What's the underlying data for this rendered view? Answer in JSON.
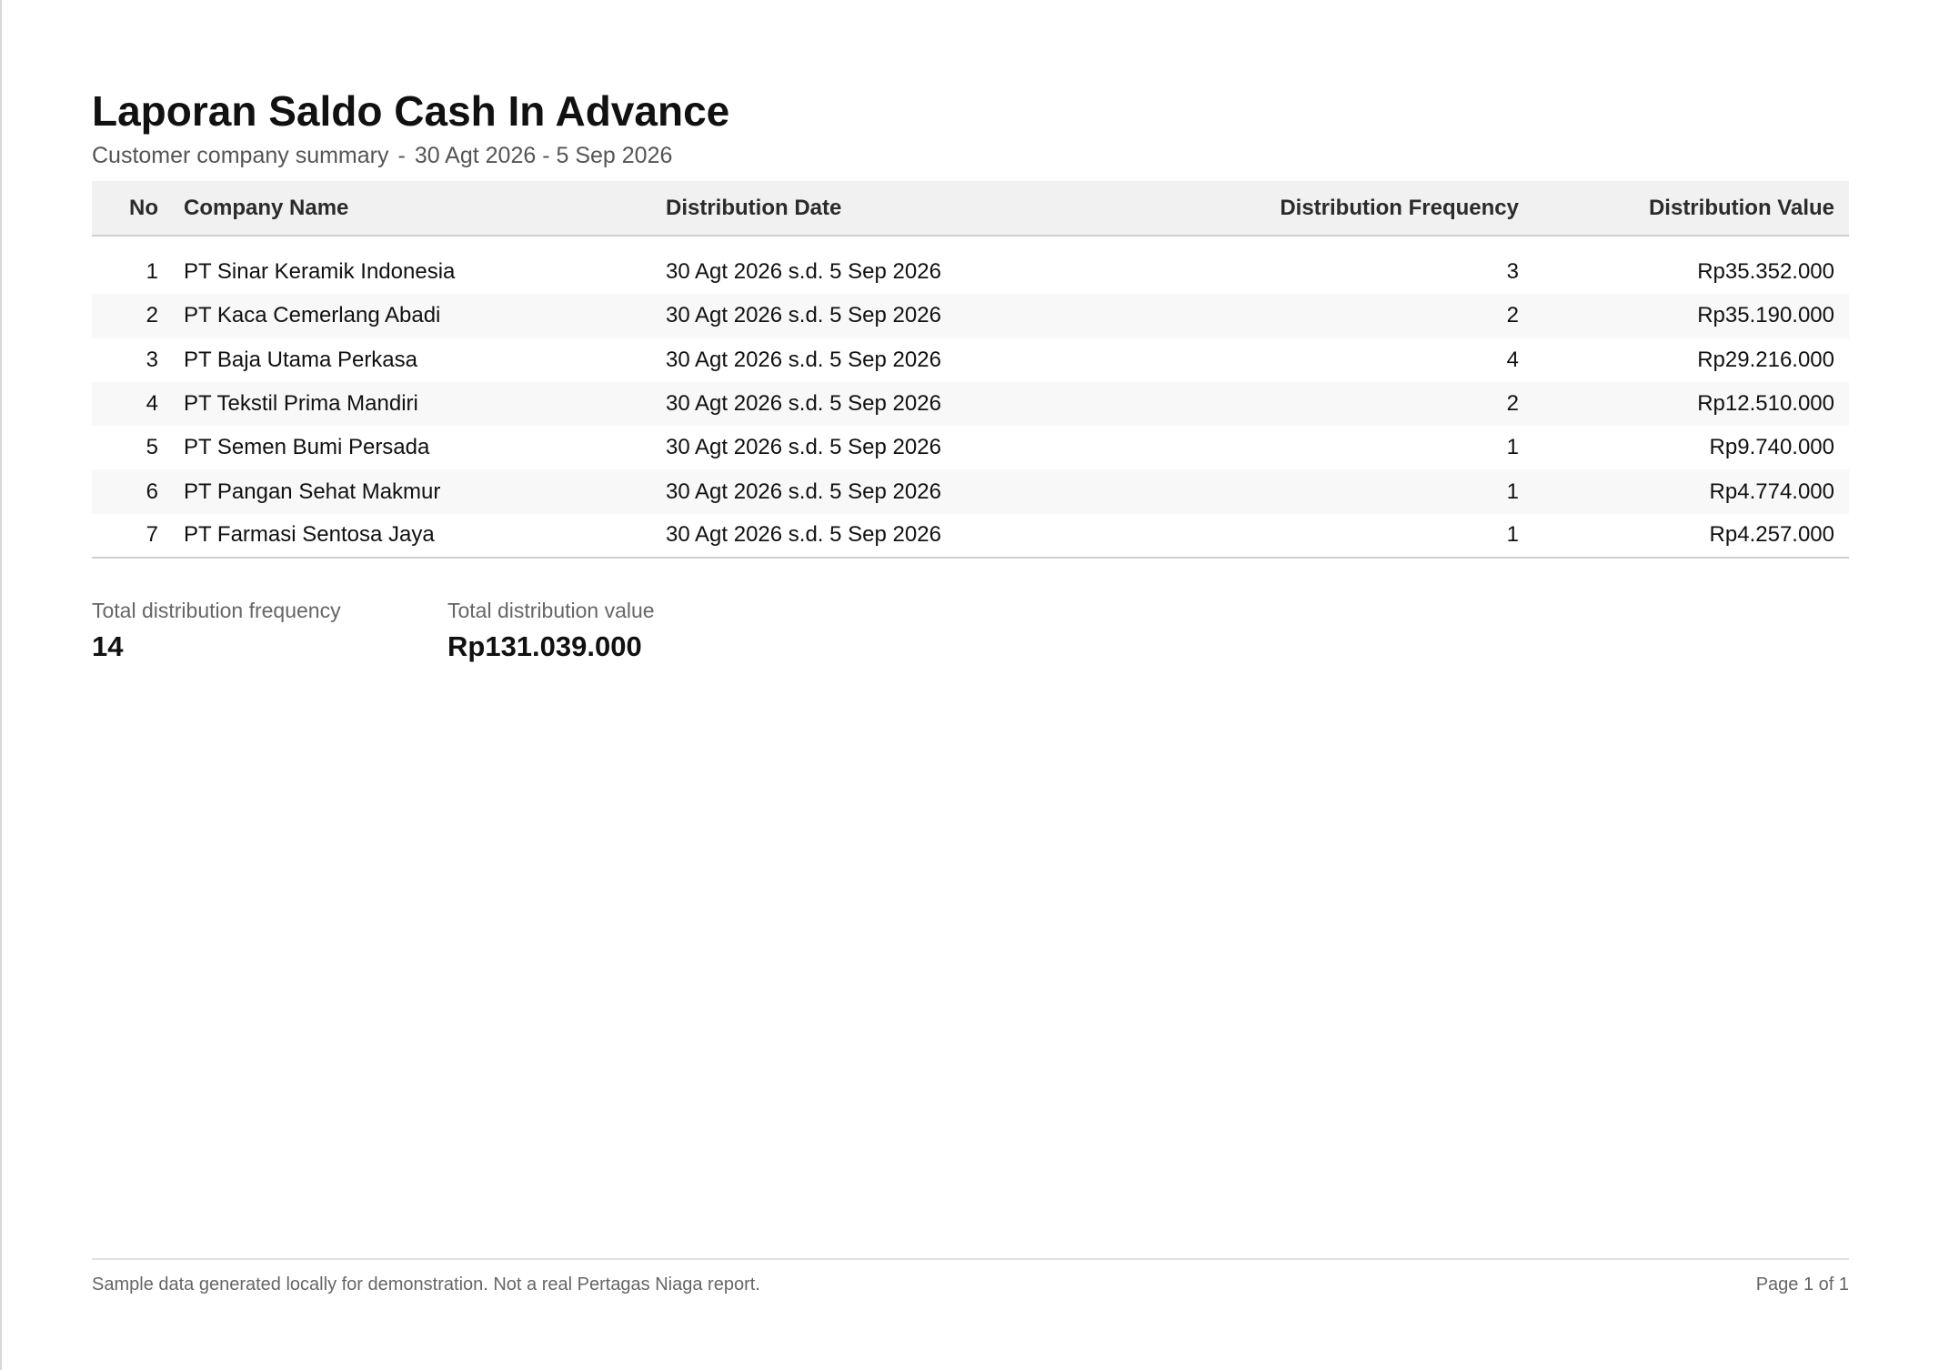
{
  "report": {
    "title": "Laporan Saldo Cash In Advance",
    "subtitle": {
      "label": "Customer company summary",
      "separator": "-",
      "period": "30 Agt 2026 - 5 Sep 2026"
    }
  },
  "table": {
    "columns": {
      "no": "No",
      "company": "Company Name",
      "date": "Distribution Date",
      "frequency": "Distribution Frequency",
      "value": "Distribution Value"
    },
    "rows": [
      {
        "no": "1",
        "company": "PT Sinar Keramik Indonesia",
        "date": "30 Agt 2026 s.d. 5 Sep 2026",
        "frequency": "3",
        "value": "Rp35.352.000"
      },
      {
        "no": "2",
        "company": "PT Kaca Cemerlang Abadi",
        "date": "30 Agt 2026 s.d. 5 Sep 2026",
        "frequency": "2",
        "value": "Rp35.190.000"
      },
      {
        "no": "3",
        "company": "PT Baja Utama Perkasa",
        "date": "30 Agt 2026 s.d. 5 Sep 2026",
        "frequency": "4",
        "value": "Rp29.216.000"
      },
      {
        "no": "4",
        "company": "PT Tekstil Prima Mandiri",
        "date": "30 Agt 2026 s.d. 5 Sep 2026",
        "frequency": "2",
        "value": "Rp12.510.000"
      },
      {
        "no": "5",
        "company": "PT Semen Bumi Persada",
        "date": "30 Agt 2026 s.d. 5 Sep 2026",
        "frequency": "1",
        "value": "Rp9.740.000"
      },
      {
        "no": "6",
        "company": "PT Pangan Sehat Makmur",
        "date": "30 Agt 2026 s.d. 5 Sep 2026",
        "frequency": "1",
        "value": "Rp4.774.000"
      },
      {
        "no": "7",
        "company": "PT Farmasi Sentosa Jaya",
        "date": "30 Agt 2026 s.d. 5 Sep 2026",
        "frequency": "1",
        "value": "Rp4.257.000"
      }
    ]
  },
  "totals": {
    "frequency_label": "Total distribution frequency",
    "frequency_value": "14",
    "value_label": "Total distribution value",
    "value_value": "Rp131.039.000"
  },
  "footer": {
    "note": "Sample data generated locally for demonstration. Not a real Pertagas Niaga report.",
    "page": "Page 1 of 1"
  }
}
